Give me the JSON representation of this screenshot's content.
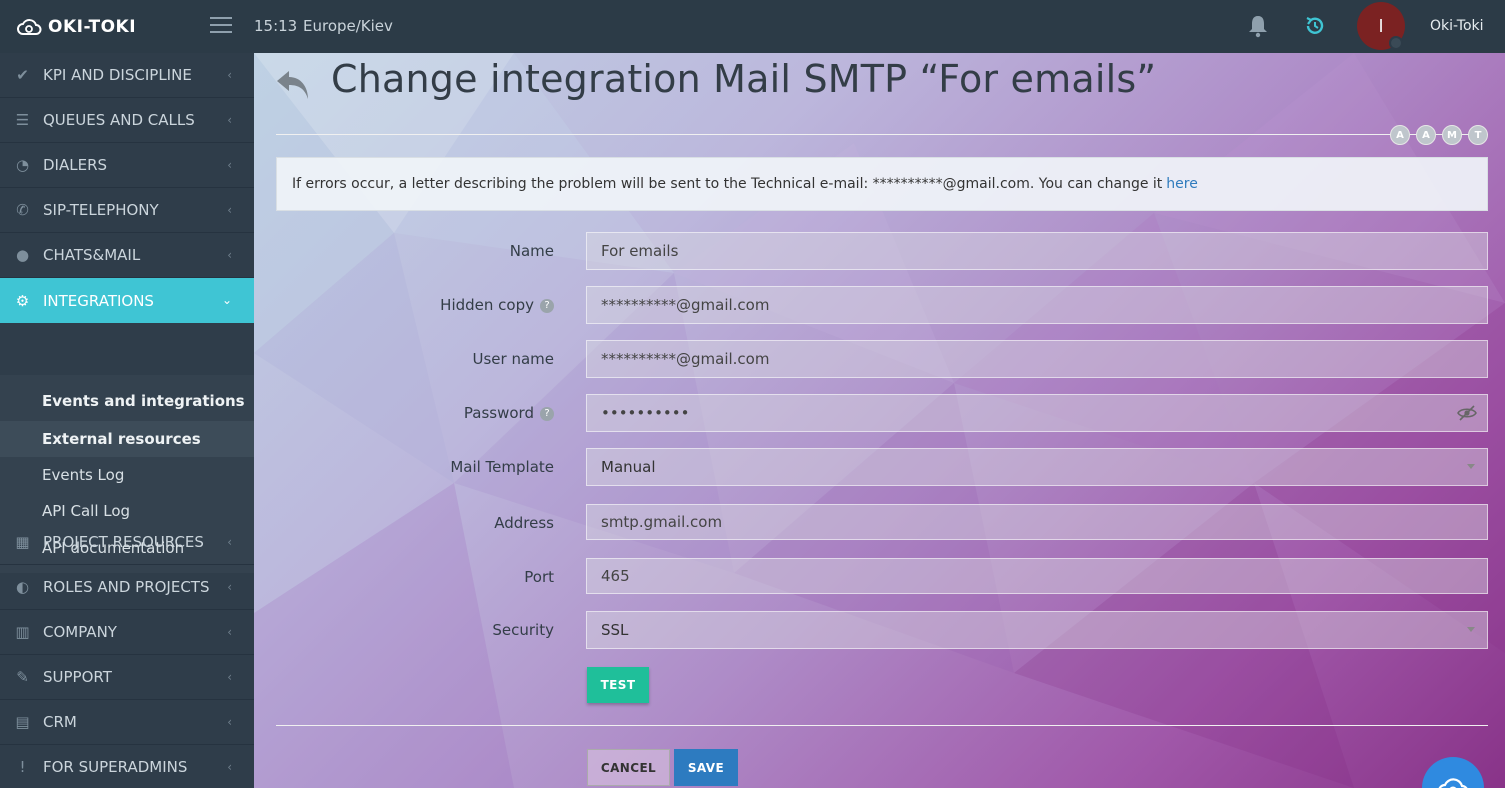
{
  "topbar": {
    "brand": "OKI-TOKI",
    "time": "15:13",
    "timezone": "Europe/Kiev",
    "avatar_letter": "I",
    "username": "Oki-Toki"
  },
  "sidebar": {
    "items": [
      {
        "label": "KPI AND DISCIPLINE",
        "icon": "check-icon"
      },
      {
        "label": "QUEUES AND CALLS",
        "icon": "list-icon"
      },
      {
        "label": "DIALERS",
        "icon": "clock-icon"
      },
      {
        "label": "SIP-TELEPHONY",
        "icon": "phone-icon"
      },
      {
        "label": "CHATS&MAIL",
        "icon": "chat-icon"
      },
      {
        "label": "INTEGRATIONS",
        "icon": "gears-icon"
      },
      {
        "label": "PROJECT RESOURCES",
        "icon": "grid-icon"
      },
      {
        "label": "ROLES AND PROJECTS",
        "icon": "toggle-icon"
      },
      {
        "label": "COMPANY",
        "icon": "bar-chart-icon"
      },
      {
        "label": "SUPPORT",
        "icon": "wrench-icon"
      },
      {
        "label": "CRM",
        "icon": "table-icon"
      },
      {
        "label": "FOR SUPERADMINS",
        "icon": "exclamation-icon"
      }
    ],
    "sub_items": [
      {
        "label": "Events and integrations"
      },
      {
        "label": "External resources"
      },
      {
        "label": "Events Log"
      },
      {
        "label": "API Call Log"
      },
      {
        "label": "API documentation"
      }
    ]
  },
  "page": {
    "title": "Change integration Mail SMTP “For emails”",
    "badges": [
      "A",
      "A",
      "M",
      "T"
    ],
    "alert_text": "If errors occur, a letter describing the problem will be sent to the Technical e-mail: **********@gmail.com. You can change it",
    "alert_link": "here"
  },
  "form": {
    "name_label": "Name",
    "name_value": "For emails",
    "hidden_copy_label": "Hidden copy",
    "hidden_copy_value": "**********@gmail.com",
    "user_name_label": "User name",
    "user_name_value": "**********@gmail.com",
    "password_label": "Password",
    "password_value": "••••••••••",
    "mail_template_label": "Mail Template",
    "mail_template_value": "Manual",
    "address_label": "Address",
    "address_value": "smtp.gmail.com",
    "port_label": "Port",
    "port_value": "465",
    "security_label": "Security",
    "security_value": "SSL",
    "help_glyph": "?"
  },
  "buttons": {
    "test": "TEST",
    "cancel": "CANCEL",
    "save": "SAVE"
  },
  "colors": {
    "topbar": "#2c3b47",
    "sidebar": "#2f3d4a",
    "active": "#3fc5d4",
    "test": "#1fbf9a",
    "save": "#2d7bc0"
  }
}
